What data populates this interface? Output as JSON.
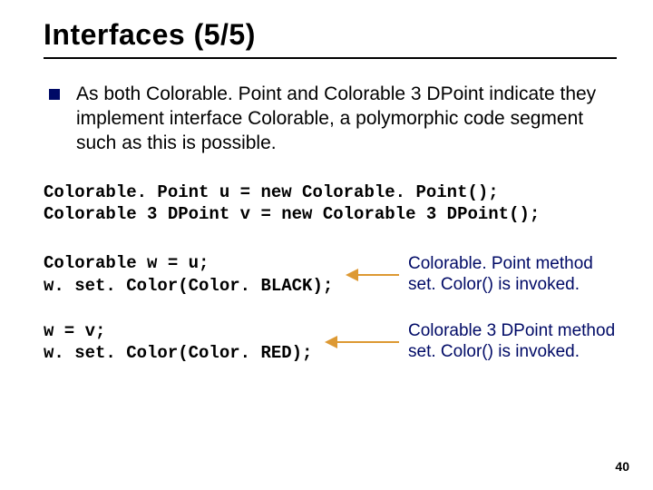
{
  "title": "Interfaces (5/5)",
  "bullet": "As both Colorable. Point and Colorable 3 DPoint indicate they implement interface Colorable, a polymorphic code segment such as this is possible.",
  "code_block1_line1": "Colorable. Point u = new Colorable. Point();",
  "code_block1_line2": "Colorable 3 DPoint v = new Colorable 3 DPoint();",
  "code_block2_line1": "Colorable w = u;",
  "code_block2_line2": "w. set. Color(Color. BLACK);",
  "annot1_line1": "Colorable. Point method",
  "annot1_line2": "set. Color() is invoked.",
  "code_block3_line1": "w = v;",
  "code_block3_line2": "w. set. Color(Color. RED);",
  "annot2_line1": "Colorable 3 DPoint method",
  "annot2_line2": "set. Color() is invoked.",
  "page_number": "40"
}
